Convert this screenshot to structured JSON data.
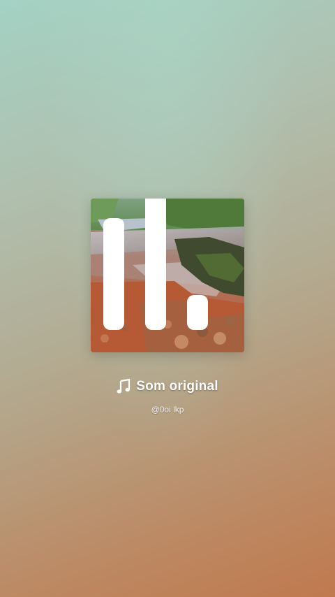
{
  "sound": {
    "title": "Som original",
    "author": "@0oi lkp"
  },
  "cover": {
    "description_icon": "video-thumbnail",
    "indicator_icon": "audio-wave-icon"
  },
  "colors": {
    "text": "#ffffff",
    "background_top": "#a3d2c4",
    "background_bottom": "#c0794e"
  }
}
